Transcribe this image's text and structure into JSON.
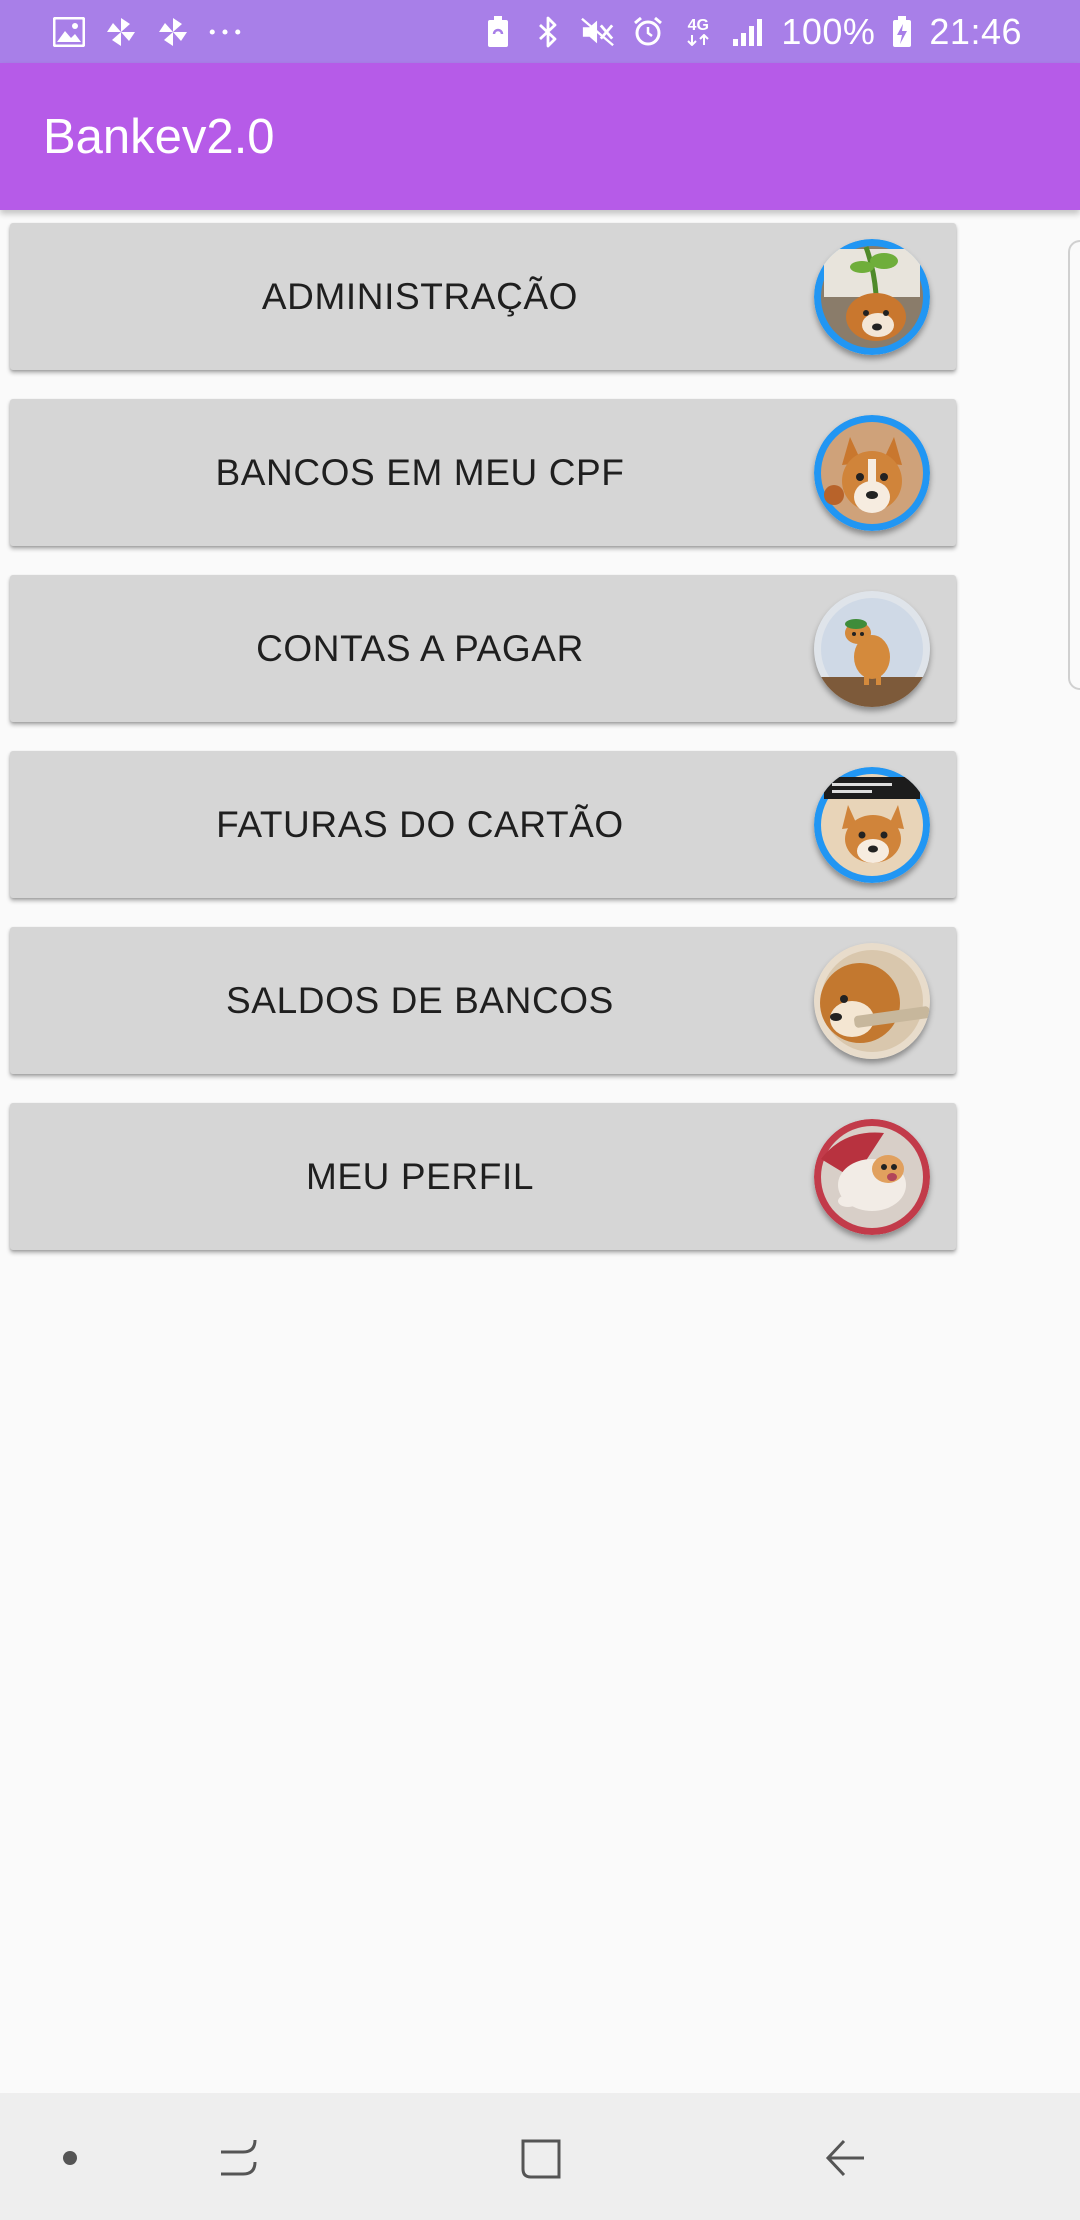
{
  "status_bar": {
    "battery": "100%",
    "network": "4G",
    "time": "21:46",
    "left_icons": [
      "gallery-icon",
      "pinwheel-icon",
      "pinwheel-icon",
      "more-dots-icon"
    ],
    "right_icons": [
      "battery-saver-icon",
      "bluetooth-icon",
      "mute-icon",
      "alarm-icon",
      "network-icon",
      "signal-icon",
      "battery-charging-icon"
    ]
  },
  "app_bar": {
    "title": "Bankev2.0"
  },
  "menu": {
    "items": [
      {
        "label": "ADMINISTRAÇÃO",
        "avatar": "corgi-plant-avatar"
      },
      {
        "label": "BANCOS EM MEU CPF",
        "avatar": "corgi-portrait-avatar"
      },
      {
        "label": "CONTAS A PAGAR",
        "avatar": "corgi-hat-avatar"
      },
      {
        "label": "FATURAS DO CARTÃO",
        "avatar": "corgi-meme-avatar"
      },
      {
        "label": "SALDOS DE BANCOS",
        "avatar": "shiba-stick-avatar"
      },
      {
        "label": "MEU PERFIL",
        "avatar": "corgi-lying-avatar"
      }
    ]
  },
  "nav_bar": {
    "buttons": [
      "dot-icon",
      "recents-icon",
      "home-icon",
      "back-icon"
    ]
  },
  "colors": {
    "status_bar": "#a87fe8",
    "app_bar": "#b65be8",
    "button_bg": "#d6d6d6",
    "page_bg": "#fafafa",
    "avatar_ring": "#2196f3"
  }
}
